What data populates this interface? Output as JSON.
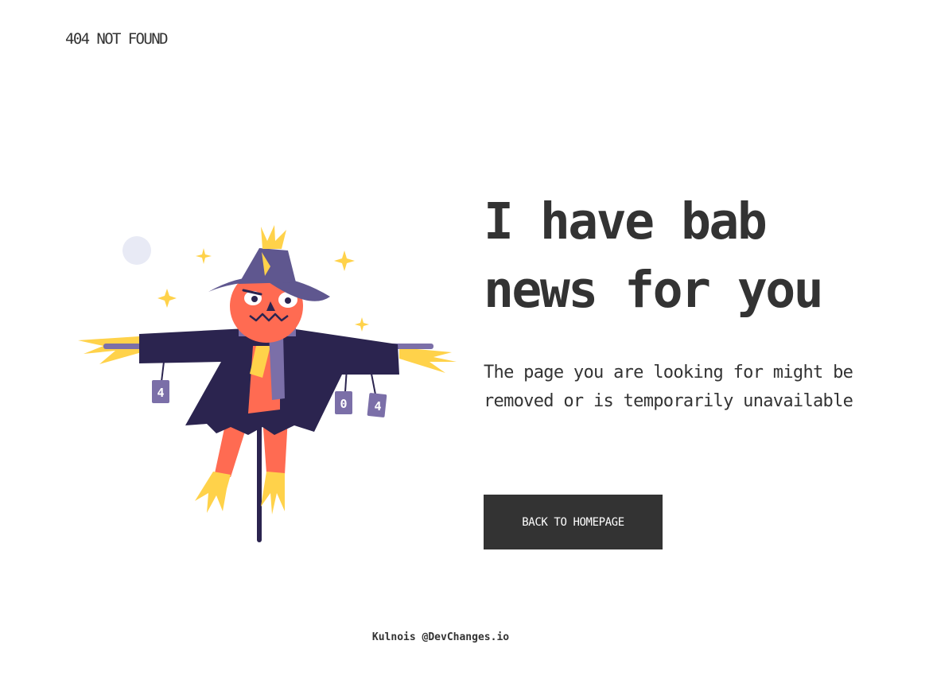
{
  "header": {
    "brand": "404 NOT FOUND"
  },
  "main": {
    "headline_line1": "I have bab",
    "headline_line2": "news for you",
    "message": "The page you are looking for might be removed or is temporarily unavailable",
    "button_label": "BACK TO HOMEPAGE"
  },
  "illustration": {
    "can_labels": [
      "4",
      "0",
      "4"
    ],
    "icon": "scarecrow-illustration"
  },
  "footer": {
    "credit": "Kulnois @DevChanges.io"
  },
  "colors": {
    "text": "#333333",
    "button_bg": "#333333",
    "button_text": "#ffffff",
    "hat": "#5f578f",
    "face": "#ff6b52",
    "coat": "#2b244f",
    "straw": "#ffd24a",
    "scarf": "#7b6fa8",
    "moon": "#e8eaf5"
  }
}
